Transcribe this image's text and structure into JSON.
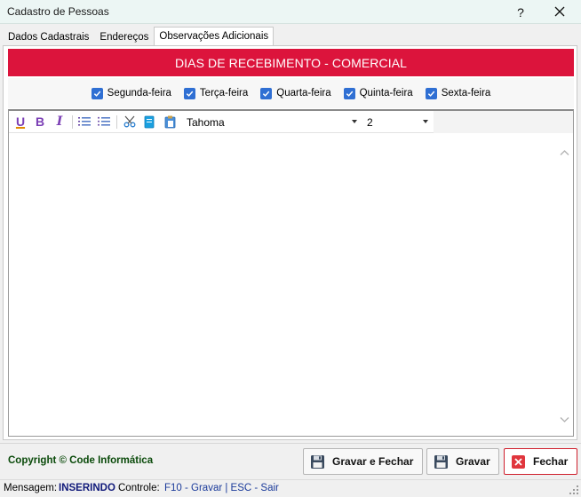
{
  "window": {
    "title": "Cadastro de Pessoas",
    "help_glyph": "?",
    "close_glyph": "✕"
  },
  "tabs": [
    {
      "label": "Dados Cadastrais",
      "active": false
    },
    {
      "label": "Endereços",
      "active": false
    },
    {
      "label": "Observações Adicionais",
      "active": true
    }
  ],
  "banner": {
    "text": "DIAS DE RECEBIMENTO - COMERCIAL",
    "color": "#dc143c"
  },
  "days": [
    {
      "label": "Segunda-feira",
      "checked": true
    },
    {
      "label": "Terça-feira",
      "checked": true
    },
    {
      "label": "Quarta-feira",
      "checked": true
    },
    {
      "label": "Quinta-feira",
      "checked": true
    },
    {
      "label": "Sexta-feira",
      "checked": true
    }
  ],
  "editor": {
    "toolbar": {
      "underline": "U",
      "bold": "B",
      "italic": "I",
      "font": "Tahoma",
      "size": "2",
      "icons": [
        "underline-icon",
        "bold-icon",
        "italic-icon",
        "numbered-list-icon",
        "bullet-list-icon",
        "cut-icon",
        "copy-icon",
        "paste-icon"
      ]
    },
    "content": ""
  },
  "footer": {
    "copyright": "Copyright © Code Informática",
    "buttons": {
      "save_close": "Gravar e Fechar",
      "save": "Gravar",
      "close": "Fechar"
    }
  },
  "status": {
    "message_label": "Mensagem:",
    "message_value": "INSERINDO",
    "control_label": "Controle:",
    "control_value": "F10 - Gravar | ESC - Sair"
  },
  "colors": {
    "accent_red": "#dc143c",
    "checkbox_blue": "#2f6fd3",
    "copyright_green": "#0a4a0a",
    "status_blue": "#111a7a"
  }
}
